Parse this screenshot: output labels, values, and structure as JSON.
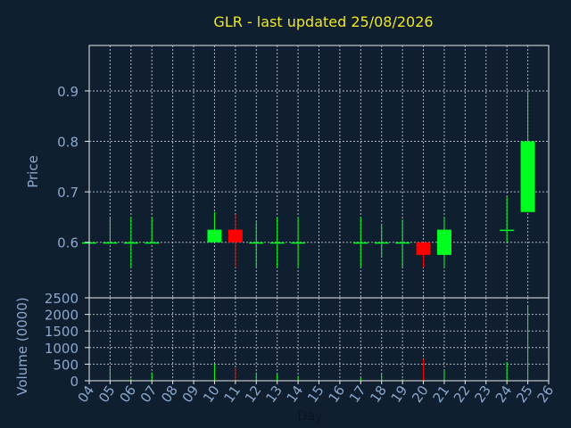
{
  "chart_data": [
    {
      "type": "candlestick",
      "title": "GLR - last updated 25/08/2026",
      "ylabel": "Price",
      "xlabel": "",
      "x_range": [
        4,
        26
      ],
      "ylim": [
        0.49,
        0.99
      ],
      "yticks": [
        "0.6",
        "0.7",
        "0.8",
        "0.9"
      ],
      "ytick_values": [
        0.6,
        0.7,
        0.8,
        0.9
      ],
      "grid": true,
      "up_color": "#00ff20",
      "down_color": "#ff0000",
      "candles": [
        {
          "day": 4,
          "open": 0.6,
          "close": 0.6,
          "high": 0.6,
          "low": 0.6
        },
        {
          "day": 5,
          "open": 0.6,
          "close": 0.6,
          "high": 0.65,
          "low": 0.6
        },
        {
          "day": 6,
          "open": 0.6,
          "close": 0.6,
          "high": 0.65,
          "low": 0.55
        },
        {
          "day": 7,
          "open": 0.6,
          "close": 0.6,
          "high": 0.65,
          "low": 0.6
        },
        {
          "day": 10,
          "open": 0.6,
          "close": 0.625,
          "high": 0.66,
          "low": 0.6
        },
        {
          "day": 11,
          "open": 0.625,
          "close": 0.6,
          "high": 0.655,
          "low": 0.55
        },
        {
          "day": 12,
          "open": 0.6,
          "close": 0.6,
          "high": 0.64,
          "low": 0.55
        },
        {
          "day": 13,
          "open": 0.6,
          "close": 0.6,
          "high": 0.65,
          "low": 0.55
        },
        {
          "day": 14,
          "open": 0.6,
          "close": 0.6,
          "high": 0.65,
          "low": 0.55
        },
        {
          "day": 17,
          "open": 0.6,
          "close": 0.6,
          "high": 0.65,
          "low": 0.55
        },
        {
          "day": 18,
          "open": 0.6,
          "close": 0.6,
          "high": 0.635,
          "low": 0.57
        },
        {
          "day": 19,
          "open": 0.6,
          "close": 0.6,
          "high": 0.645,
          "low": 0.55
        },
        {
          "day": 20,
          "open": 0.6,
          "close": 0.575,
          "high": 0.6,
          "low": 0.55
        },
        {
          "day": 21,
          "open": 0.575,
          "close": 0.625,
          "high": 0.65,
          "low": 0.55
        },
        {
          "day": 24,
          "open": 0.625,
          "close": 0.625,
          "high": 0.69,
          "low": 0.6
        },
        {
          "day": 25,
          "open": 0.66,
          "close": 0.8,
          "high": 0.9,
          "low": 0.66
        }
      ]
    },
    {
      "type": "bar",
      "ylabel": "Volume (0000)",
      "xlabel": "Day",
      "x_range": [
        4,
        26
      ],
      "ylim": [
        0,
        2500
      ],
      "yticks": [
        "0",
        "500",
        "1000",
        "1500",
        "2000",
        "2500"
      ],
      "ytick_values": [
        0,
        500,
        1000,
        1500,
        2000,
        2500
      ],
      "xticks": [
        "04",
        "05",
        "06",
        "07",
        "08",
        "09",
        "10",
        "11",
        "12",
        "13",
        "14",
        "15",
        "16",
        "17",
        "18",
        "19",
        "20",
        "21",
        "22",
        "23",
        "24",
        "25",
        "26"
      ],
      "grid": true,
      "bars": [
        {
          "day": 4,
          "value": 30,
          "color": "#00ff20"
        },
        {
          "day": 5,
          "value": 400,
          "color": "#00ff20"
        },
        {
          "day": 6,
          "value": 60,
          "color": "#00ff20"
        },
        {
          "day": 7,
          "value": 250,
          "color": "#00ff20"
        },
        {
          "day": 10,
          "value": 500,
          "color": "#00ff20"
        },
        {
          "day": 11,
          "value": 380,
          "color": "#ff0000"
        },
        {
          "day": 12,
          "value": 250,
          "color": "#00ff20"
        },
        {
          "day": 13,
          "value": 200,
          "color": "#00ff20"
        },
        {
          "day": 14,
          "value": 150,
          "color": "#00ff20"
        },
        {
          "day": 17,
          "value": 80,
          "color": "#00ff20"
        },
        {
          "day": 18,
          "value": 200,
          "color": "#00ff20"
        },
        {
          "day": 19,
          "value": 50,
          "color": "#00ff20"
        },
        {
          "day": 20,
          "value": 650,
          "color": "#ff0000"
        },
        {
          "day": 21,
          "value": 320,
          "color": "#00ff20"
        },
        {
          "day": 24,
          "value": 550,
          "color": "#00ff20"
        },
        {
          "day": 25,
          "value": 2250,
          "color": "#00ff20"
        }
      ]
    }
  ]
}
